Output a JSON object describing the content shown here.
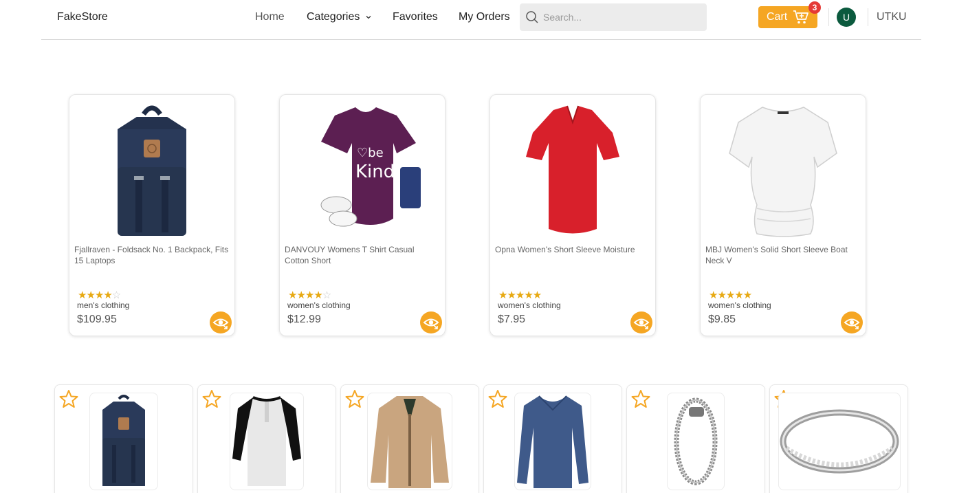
{
  "nav": {
    "brand": "FakeStore",
    "home": "Home",
    "categories": "Categories",
    "favorites": "Favorites",
    "orders": "My Orders",
    "search_placeholder": "Search...",
    "cart_label": "Cart",
    "cart_count": "3",
    "avatar_initial": "U",
    "username": "UTKU"
  },
  "colors": {
    "accent": "#f5a623",
    "badge": "#e53935",
    "avatar": "#0b5a3e",
    "star": "#e7a912"
  },
  "products": [
    {
      "title": "Fjallraven - Foldsack No. 1 Backpack, Fits 15 Laptops",
      "rating": 3.9,
      "category": "men's clothing",
      "price": "$109.95",
      "icon": "backpack-image"
    },
    {
      "title": "DANVOUY Womens T Shirt Casual Cotton Short",
      "rating": 3.6,
      "category": "women's clothing",
      "price": "$12.99",
      "icon": "purple-tshirt-image"
    },
    {
      "title": "Opna Women's Short Sleeve Moisture",
      "rating": 4.5,
      "category": "women's clothing",
      "price": "$7.95",
      "icon": "red-tshirt-image"
    },
    {
      "title": "MBJ Women's Solid Short Sleeve Boat Neck V",
      "rating": 4.7,
      "category": "women's clothing",
      "price": "$9.85",
      "icon": "white-tshirt-image"
    }
  ],
  "favorites_row": [
    {
      "icon": "backpack-image"
    },
    {
      "icon": "henley-shirt-image"
    },
    {
      "icon": "jacket-image"
    },
    {
      "icon": "blue-longsleeve-image"
    },
    {
      "icon": "bracelet-image"
    },
    {
      "icon": "ring-image"
    }
  ]
}
